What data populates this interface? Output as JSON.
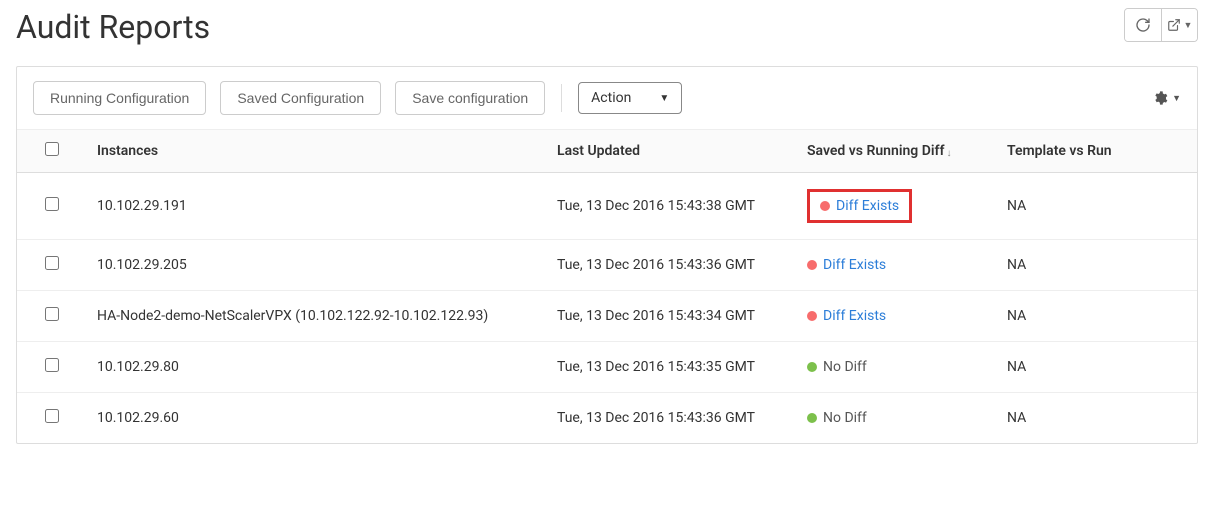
{
  "page": {
    "title": "Audit Reports"
  },
  "toolbar": {
    "running_config": "Running Configuration",
    "saved_config": "Saved Configuration",
    "save_config": "Save configuration",
    "action": "Action"
  },
  "table": {
    "headers": {
      "instances": "Instances",
      "last_updated": "Last Updated",
      "saved_vs_running": "Saved vs Running Diff",
      "template_vs_run": "Template vs Run"
    },
    "rows": [
      {
        "instance": "10.102.29.191",
        "last_updated": "Tue, 13 Dec 2016 15:43:38 GMT",
        "diff_status": "diff",
        "diff_label": "Diff Exists",
        "template": "NA",
        "highlight": true
      },
      {
        "instance": "10.102.29.205",
        "last_updated": "Tue, 13 Dec 2016 15:43:36 GMT",
        "diff_status": "diff",
        "diff_label": "Diff Exists",
        "template": "NA",
        "highlight": false
      },
      {
        "instance": "HA-Node2-demo-NetScalerVPX (10.102.122.92-10.102.122.93)",
        "last_updated": "Tue, 13 Dec 2016 15:43:34 GMT",
        "diff_status": "diff",
        "diff_label": "Diff Exists",
        "template": "NA",
        "highlight": false
      },
      {
        "instance": "10.102.29.80",
        "last_updated": "Tue, 13 Dec 2016 15:43:35 GMT",
        "diff_status": "nodiff",
        "diff_label": "No Diff",
        "template": "NA",
        "highlight": false
      },
      {
        "instance": "10.102.29.60",
        "last_updated": "Tue, 13 Dec 2016 15:43:36 GMT",
        "diff_status": "nodiff",
        "diff_label": "No Diff",
        "template": "NA",
        "highlight": false
      }
    ]
  }
}
